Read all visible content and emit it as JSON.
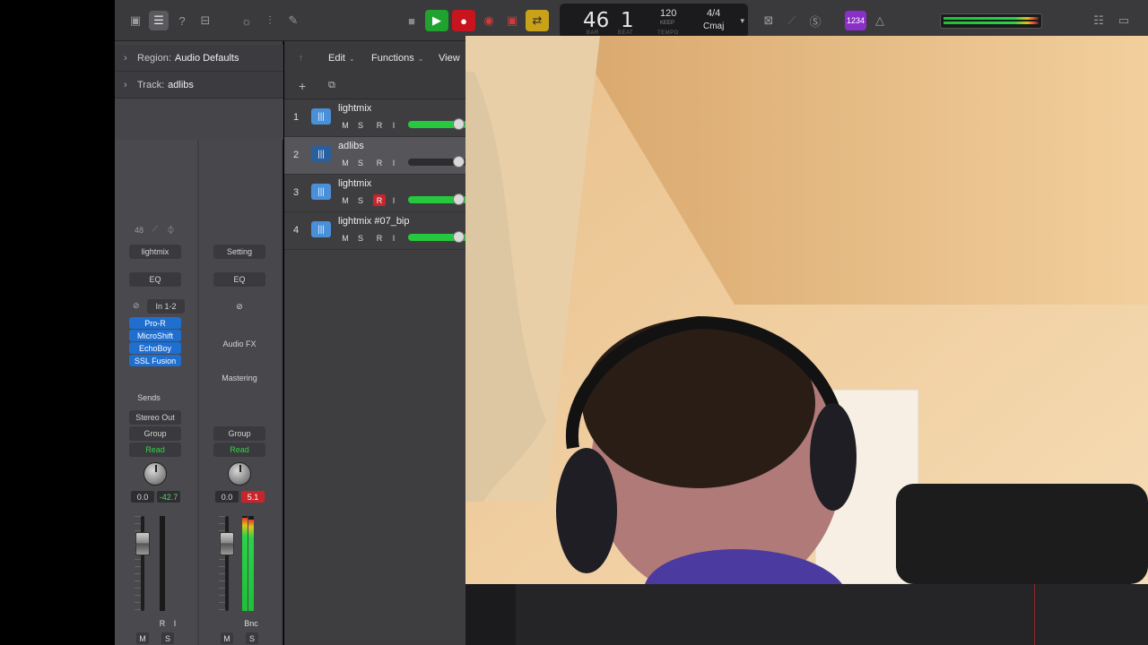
{
  "control_bar": {
    "lcd": {
      "bar": "46",
      "beat": "1",
      "bar_label": "BAR",
      "beat_label": "BEAT",
      "tempo": "120",
      "tempo_mode": "KEEP",
      "tempo_label": "TEMPO",
      "signature": "4/4",
      "key": "Cmaj"
    },
    "count_in": "1234"
  },
  "inspector": {
    "region_label": "Region:",
    "region_value": "Audio Defaults",
    "track_label": "Track:",
    "track_value": "adlibs",
    "strip1": {
      "gain": "48",
      "name": "lightmix",
      "eq": "EQ",
      "input": "In 1-2",
      "plugins": [
        "Pro-R",
        "MicroShift",
        "EchoBoy",
        "SSL Fusion"
      ],
      "sends": "Sends",
      "output": "Stereo Out",
      "group": "Group",
      "automation": "Read",
      "volume": "0.0",
      "peak": "-42.7",
      "r_btn": "R",
      "i_btn": "I",
      "m_btn": "M",
      "s_btn": "S"
    },
    "strip2": {
      "name": "Setting",
      "eq": "EQ",
      "audio_fx": "Audio FX",
      "mastering": "Mastering",
      "group": "Group",
      "automation": "Read",
      "volume": "0.0",
      "peak": "5.1",
      "bnc": "Bnc",
      "m_btn": "M",
      "s_btn": "S"
    }
  },
  "tracks_header": {
    "edit": "Edit",
    "functions": "Functions",
    "view": "View"
  },
  "tracks": [
    {
      "num": "1",
      "name": "lightmix",
      "m": "M",
      "s": "S",
      "r": "R",
      "i": "I"
    },
    {
      "num": "2",
      "name": "adlibs",
      "m": "M",
      "s": "S",
      "r": "R",
      "i": "I"
    },
    {
      "num": "3",
      "name": "lightmix",
      "m": "M",
      "s": "S",
      "r": "R",
      "i": "I"
    },
    {
      "num": "4",
      "name": "lightmix #07_bip",
      "m": "M",
      "s": "S",
      "r": "R",
      "i": "I"
    }
  ],
  "colors": {
    "play": "#1fa22e",
    "record": "#c8141c",
    "cycle": "#c9a21a",
    "plugin": "#1f6fd1",
    "track_icon": "#4a90d9",
    "volume_green": "#26c93e"
  }
}
